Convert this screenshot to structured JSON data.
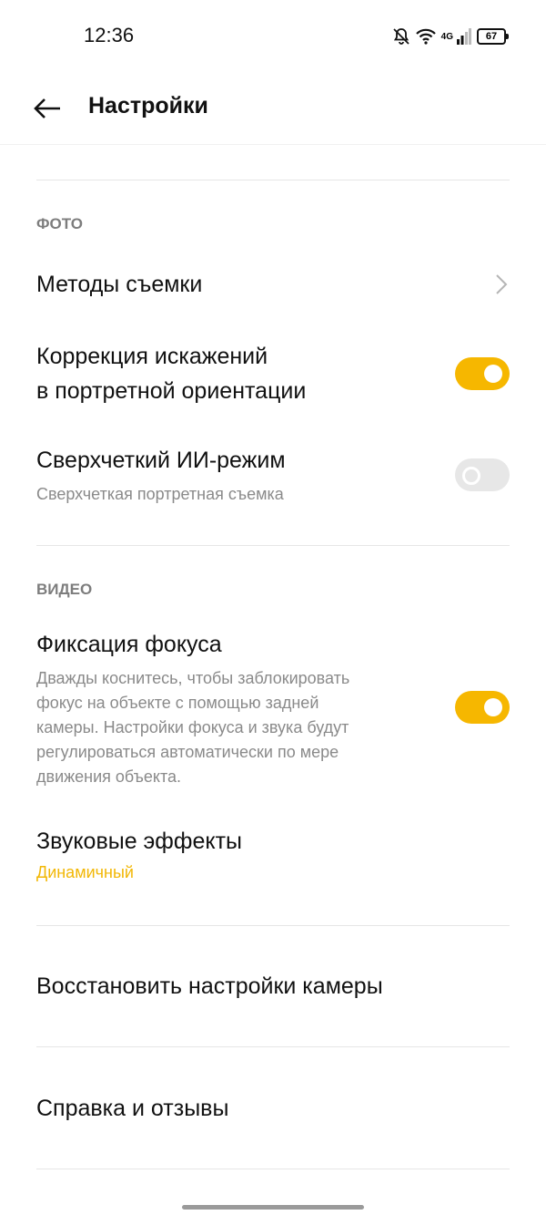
{
  "status_bar": {
    "time": "12:36",
    "network": "4G",
    "battery": "67",
    "icons": [
      "bell-off-icon",
      "wifi-icon",
      "signal-icon",
      "battery-icon"
    ]
  },
  "header": {
    "title": "Настройки",
    "back_icon": "arrow-left-icon"
  },
  "sections": {
    "photo": {
      "label": "ФОТО",
      "items": {
        "shooting_methods": {
          "title": "Методы съемки",
          "icon": "chevron-right-icon"
        },
        "distortion_correction": {
          "title_line1": "Коррекция искажений",
          "title_line2": "в портретной ориентации",
          "enabled": true
        },
        "ultra_clear": {
          "title": "Сверхчеткий ИИ-режим",
          "subtitle": "Сверхчеткая портретная съемка",
          "enabled": false
        }
      }
    },
    "video": {
      "label": "ВИДЕО",
      "items": {
        "focus_lock": {
          "title": "Фиксация фокуса",
          "desc_lines": [
            "Дважды коснитесь, чтобы заблокировать",
            "фокус на объекте с помощью задней",
            "камеры. Настройки фокуса и звука будут",
            "регулироваться автоматически по мере",
            "движения объекта."
          ],
          "enabled": true
        },
        "sound_effects": {
          "title": "Звуковые эффекты",
          "value": "Динамичный"
        }
      }
    },
    "other": {
      "restore": "Восстановить настройки камеры",
      "help": "Справка и отзывы"
    }
  },
  "colors": {
    "accent": "#f6b700",
    "accent_text": "#f2b705",
    "toggle_off": "#e7e7e7"
  }
}
